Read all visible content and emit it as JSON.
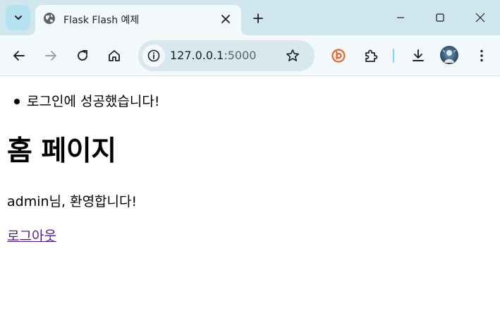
{
  "browser": {
    "tab": {
      "title": "Flask Flash 예제"
    },
    "address_bar": {
      "host": "127.0.0.1",
      "port": ":5000"
    },
    "icons": {
      "tab_search": "chevron-down-icon",
      "favicon": "globe-icon",
      "tab_close": "close-icon",
      "new_tab": "plus-icon",
      "minimize": "minimize-icon",
      "maximize": "maximize-icon",
      "close_window": "close-icon",
      "back": "arrow-left-icon",
      "forward": "arrow-right-icon",
      "reload": "reload-icon",
      "home": "home-icon",
      "site_info": "info-icon",
      "bookmark": "star-icon",
      "extension_b": "b-extension-icon",
      "extensions": "puzzle-icon",
      "downloads": "download-icon",
      "profile": "avatar",
      "menu": "kebab-menu-icon"
    },
    "colors": {
      "tab_strip": "#cfe6ee",
      "toolbar": "#f3f8fa",
      "omnibox": "#d8e8ee",
      "extension_accent": "#e8642c",
      "separator": "#7fd6f0"
    }
  },
  "page": {
    "flash_messages": [
      "로그인에 성공했습니다!"
    ],
    "heading": "홈 페이지",
    "welcome": "admin님, 환영합니다!",
    "logout_link": "로그아웃",
    "colors": {
      "visited_link": "#551a8b"
    }
  }
}
